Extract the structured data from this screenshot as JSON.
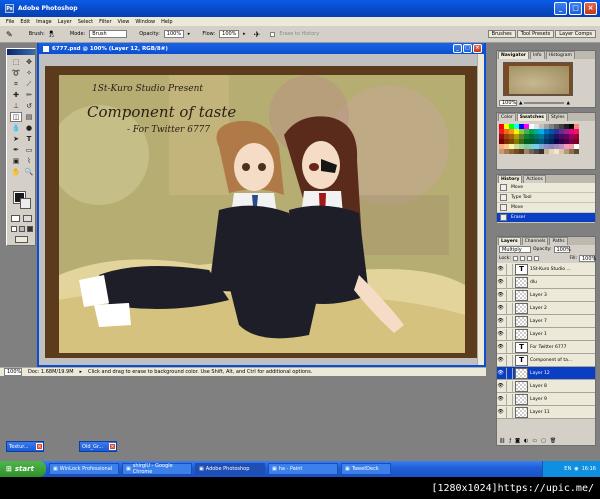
{
  "window": {
    "title": "Adobe Photoshop"
  },
  "menu": [
    "File",
    "Edit",
    "Image",
    "Layer",
    "Select",
    "Filter",
    "View",
    "Window",
    "Help"
  ],
  "options": {
    "brush_label": "Brush:",
    "brush_size": "35",
    "mode_label": "Mode:",
    "mode_value": "Brush",
    "opacity_label": "Opacity:",
    "opacity_value": "100%",
    "flow_label": "Flow:",
    "flow_value": "100%",
    "erase_history": "Erase to History"
  },
  "wells": [
    "Brushes",
    "Tool Presets",
    "Layer Comps"
  ],
  "document": {
    "title": "6777.psd @ 100% (Layer 12, RGB/8#)",
    "art_line1": "1St-Kuro Studio Present",
    "art_line2": "Component of taste",
    "art_line3": "- For Twitter 6777",
    "zoom": "100%",
    "doc_info": "Doc: 1.68M/19.9M",
    "status_hint": "Click and drag to erase to background color.  Use Shift, Alt, and Ctrl for additional options."
  },
  "minimized": [
    {
      "label": "Textur..."
    },
    {
      "label": "Old_Gr..."
    }
  ],
  "navigator": {
    "tabs": [
      "Navigator",
      "Info",
      "Histogram"
    ],
    "zoom": "100%"
  },
  "swatches": {
    "tabs": [
      "Color",
      "Swatches",
      "Styles"
    ],
    "colors": [
      "#ff0000",
      "#ffff00",
      "#00ff00",
      "#00ffff",
      "#0000ff",
      "#ff00ff",
      "#ffffff",
      "#e0e0e0",
      "#c0c0c0",
      "#a0a0a0",
      "#808080",
      "#606060",
      "#404040",
      "#202020",
      "#000000",
      "#ff8080",
      "#ed1c24",
      "#f26522",
      "#f7941d",
      "#fff200",
      "#8dc63f",
      "#39b54a",
      "#00a651",
      "#00a99d",
      "#00aeef",
      "#0072bc",
      "#0054a6",
      "#2e3192",
      "#662d91",
      "#92278f",
      "#ec008c",
      "#ed145b",
      "#9e0b0f",
      "#a0410d",
      "#a36209",
      "#aba000",
      "#598527",
      "#1a7b30",
      "#007236",
      "#00746b",
      "#0076a3",
      "#004b80",
      "#003471",
      "#1b1464",
      "#440e62",
      "#630460",
      "#9e005d",
      "#9e0039",
      "#790000",
      "#7b2e00",
      "#7d4900",
      "#827b00",
      "#406618",
      "#005e20",
      "#005826",
      "#005952",
      "#005b7f",
      "#003663",
      "#002157",
      "#0d004c",
      "#32004b",
      "#4b0049",
      "#7b0046",
      "#7a0026",
      "#f9ad81",
      "#fdc68a",
      "#fff79a",
      "#c4df9b",
      "#a3d39c",
      "#82ca9d",
      "#7bcdc8",
      "#6ecff6",
      "#7ea7d8",
      "#8493ca",
      "#8882be",
      "#a187be",
      "#bc8dbf",
      "#f49ac2",
      "#f6989d",
      "#ffffff",
      "#c69c6d",
      "#a67c52",
      "#8c6239",
      "#754c24",
      "#603913",
      "#998675",
      "#736357",
      "#534741",
      "#362f2d",
      "#c7b299",
      "#e6d5b8",
      "#f2e6d0",
      "#d9c3a5",
      "#b59a78",
      "#8a6f50",
      "#5e4a35"
    ]
  },
  "history": {
    "tabs": [
      "History",
      "Actions"
    ],
    "rows": [
      "Move",
      "Type Tool",
      "Move",
      "Eraser"
    ],
    "selected": "Eraser"
  },
  "layers": {
    "tabs": [
      "Layers",
      "Channels",
      "Paths"
    ],
    "blend": "Multiply",
    "opacity_label": "Opacity:",
    "opacity": "100%",
    "lock_label": "Lock:",
    "fill_label": "Fill:",
    "fill": "100%",
    "rows": [
      {
        "name": "1St-Kuro Studio ...",
        "type": "text"
      },
      {
        "name": "dlu",
        "type": "image"
      },
      {
        "name": "Layer 3",
        "type": "image"
      },
      {
        "name": "Layer 2",
        "type": "image"
      },
      {
        "name": "Layer 7",
        "type": "image"
      },
      {
        "name": "Layer 1",
        "type": "image"
      },
      {
        "name": "For Twitter 6777",
        "type": "text"
      },
      {
        "name": "Component of ta...",
        "type": "text"
      },
      {
        "name": "Layer 12",
        "type": "image"
      },
      {
        "name": "Layer 8",
        "type": "image"
      },
      {
        "name": "Layer 9",
        "type": "image"
      },
      {
        "name": "Layer 11",
        "type": "image"
      }
    ],
    "selected": "Layer 12"
  },
  "taskbar": {
    "start": "start",
    "tasks": [
      "WinLock Professional",
      "shirgiU - Google Chrome",
      "Adobe Photoshop",
      "ha - Paint",
      "TweetDeck"
    ],
    "active": "Adobe Photoshop",
    "lang": "EN",
    "time": "16:16"
  },
  "watermark": "[1280x1024]https://upic.me/"
}
